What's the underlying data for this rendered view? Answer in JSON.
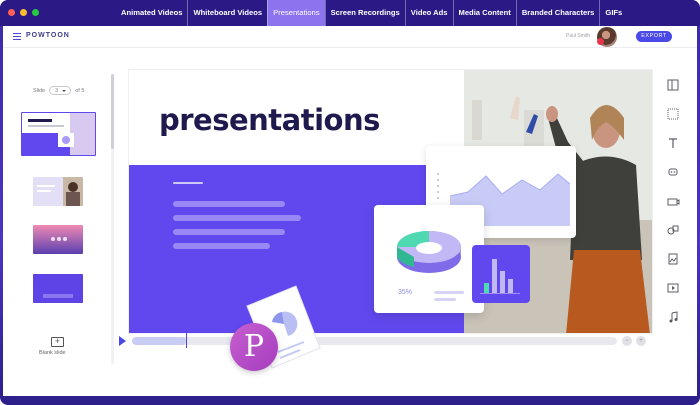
{
  "window": {
    "traffic_lights": [
      "#ff5f57",
      "#febc2e",
      "#28c840"
    ],
    "nav_tabs": [
      {
        "label": "Animated Videos",
        "active": false
      },
      {
        "label": "Whiteboard Videos",
        "active": false
      },
      {
        "label": "Presentations",
        "active": true
      },
      {
        "label": "Screen Recordings",
        "active": false
      },
      {
        "label": "Video Ads",
        "active": false
      },
      {
        "label": "Media Content",
        "active": false
      },
      {
        "label": "Branded Characters",
        "active": false
      },
      {
        "label": "GIFs",
        "active": false
      }
    ]
  },
  "header": {
    "logo": "POWTOON",
    "username": "Paul Smith",
    "export_label": "EXPORT"
  },
  "slides_panel": {
    "slide_label": "Slide",
    "current_slide": "3",
    "of_label": "of 5",
    "blank_slide_label": "Blank slide"
  },
  "canvas": {
    "title": "presentations",
    "percent_label": "35%"
  },
  "toolbar": {
    "tools": [
      "layout-icon",
      "background-icon",
      "text-icon",
      "characters-icon",
      "props-icon",
      "shapes-icon",
      "media-icon",
      "video-icon",
      "music-icon"
    ]
  },
  "colors": {
    "accent": "#4a49e8",
    "slide_purple": "#6148ee",
    "frame_purple": "#2b1a86",
    "ppt_badge": "#b84ac8"
  }
}
